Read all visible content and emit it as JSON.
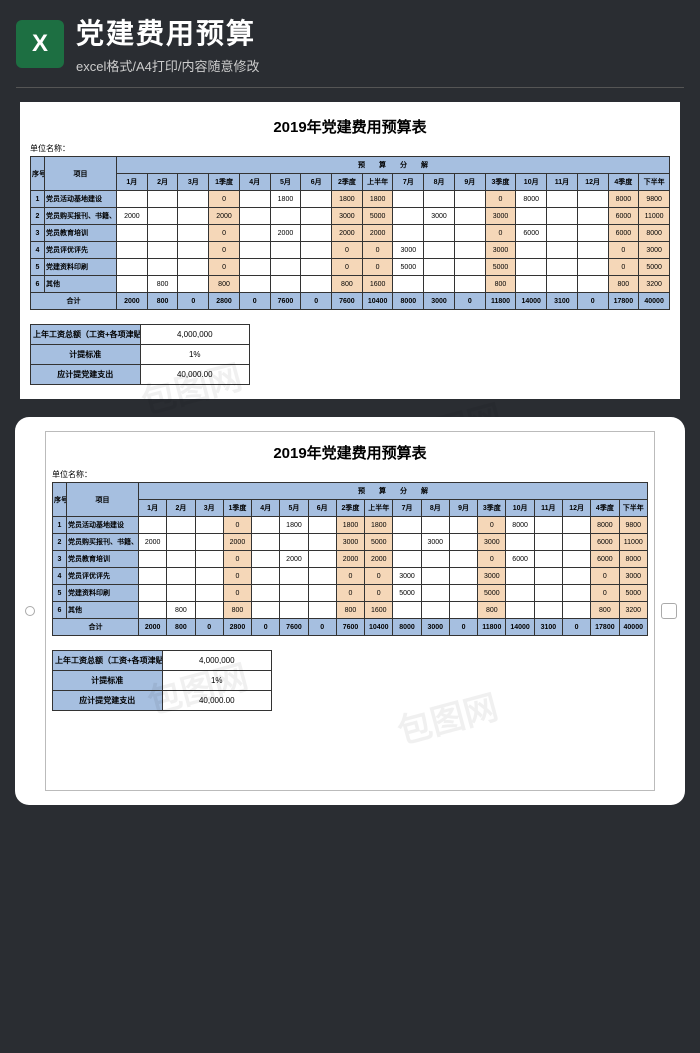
{
  "header": {
    "title": "党建费用预算",
    "subtitle": "excel格式/A4打印/内容随意修改"
  },
  "sheet": {
    "title": "2019年党建费用预算表",
    "unit_label": "单位名称：",
    "head_seq": "序号",
    "head_item": "项目",
    "head_group": "预　　算　　分　　解",
    "cols": [
      "1月",
      "2月",
      "3月",
      "1季度",
      "4月",
      "5月",
      "6月",
      "2季度",
      "上半年",
      "7月",
      "8月",
      "9月",
      "3季度",
      "10月",
      "11月",
      "12月",
      "4季度",
      "下半年"
    ],
    "rows": [
      {
        "idx": "1",
        "name": "党员活动基地建设",
        "v": [
          "",
          "",
          "",
          "0",
          "",
          "1800",
          "",
          "1800",
          "1800",
          "",
          "",
          "",
          "0",
          "8000",
          "",
          "",
          "8000",
          "9800"
        ]
      },
      {
        "idx": "2",
        "name": "党员购买报刊、书籍、音像资料",
        "v": [
          "2000",
          "",
          "",
          "2000",
          "",
          "",
          "",
          "3000",
          "5000",
          "",
          "3000",
          "",
          "3000",
          "",
          "",
          "",
          "6000",
          "11000"
        ]
      },
      {
        "idx": "3",
        "name": "党员教育培训",
        "v": [
          "",
          "",
          "",
          "0",
          "",
          "2000",
          "",
          "2000",
          "2000",
          "",
          "",
          "",
          "0",
          "6000",
          "",
          "",
          "6000",
          "8000"
        ]
      },
      {
        "idx": "4",
        "name": "党员评优评先",
        "v": [
          "",
          "",
          "",
          "0",
          "",
          "",
          "",
          "0",
          "0",
          "3000",
          "",
          "",
          "3000",
          "",
          "",
          "",
          "0",
          "3000"
        ]
      },
      {
        "idx": "5",
        "name": "党建资料印刷",
        "v": [
          "",
          "",
          "",
          "0",
          "",
          "",
          "",
          "0",
          "0",
          "5000",
          "",
          "",
          "5000",
          "",
          "",
          "",
          "0",
          "5000"
        ]
      },
      {
        "idx": "6",
        "name": "其他",
        "v": [
          "",
          "800",
          "",
          "800",
          "",
          "",
          "",
          "800",
          "1600",
          "",
          "",
          "",
          "800",
          "",
          "",
          "",
          "800",
          "3200"
        ]
      }
    ],
    "sum_label": "合计",
    "sum": [
      "2000",
      "800",
      "0",
      "2800",
      "0",
      "7600",
      "0",
      "7600",
      "10400",
      "8000",
      "3000",
      "0",
      "11800",
      "14000",
      "3100",
      "0",
      "17800",
      "40000"
    ],
    "summary": [
      {
        "label": "上年工资总额（工资+各项津贴）",
        "value": "4,000,000"
      },
      {
        "label": "计提标准",
        "value": "1%"
      },
      {
        "label": "应计提党建支出",
        "value": "40,000.00"
      }
    ]
  },
  "watermark": "包图网"
}
